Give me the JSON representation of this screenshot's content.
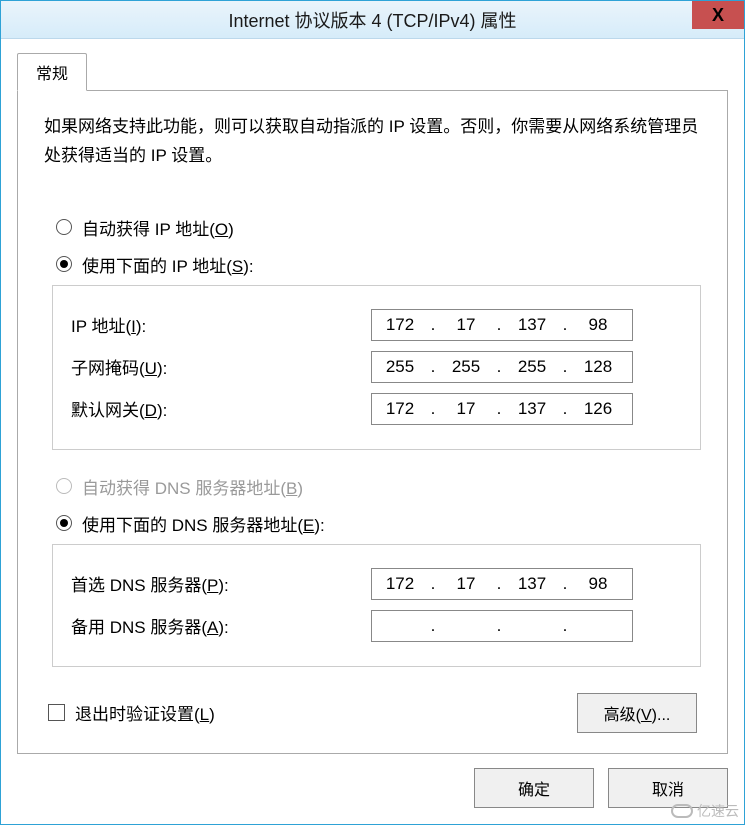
{
  "window": {
    "title": "Internet 协议版本 4 (TCP/IPv4) 属性",
    "close": "X"
  },
  "tab": {
    "general": "常规"
  },
  "description": "如果网络支持此功能，则可以获取自动指派的 IP 设置。否则，你需要从网络系统管理员处获得适当的 IP 设置。",
  "radios": {
    "auto_ip_prefix": "自动获得 IP 地址(",
    "auto_ip_key": "O",
    "auto_ip_suffix": ")",
    "manual_ip_prefix": "使用下面的 IP 地址(",
    "manual_ip_key": "S",
    "manual_ip_suffix": "):",
    "auto_dns_prefix": "自动获得 DNS 服务器地址(",
    "auto_dns_key": "B",
    "auto_dns_suffix": ")",
    "manual_dns_prefix": "使用下面的 DNS 服务器地址(",
    "manual_dns_key": "E",
    "manual_dns_suffix": "):"
  },
  "fields": {
    "ip": {
      "label_prefix": "IP 地址(",
      "key": "I",
      "label_suffix": "):",
      "o1": "172",
      "o2": "17",
      "o3": "137",
      "o4": "98"
    },
    "mask": {
      "label_prefix": "子网掩码(",
      "key": "U",
      "label_suffix": "):",
      "o1": "255",
      "o2": "255",
      "o3": "255",
      "o4": "128"
    },
    "gateway": {
      "label_prefix": "默认网关(",
      "key": "D",
      "label_suffix": "):",
      "o1": "172",
      "o2": "17",
      "o3": "137",
      "o4": "126"
    },
    "dns1": {
      "label_prefix": "首选 DNS 服务器(",
      "key": "P",
      "label_suffix": "):",
      "o1": "172",
      "o2": "17",
      "o3": "137",
      "o4": "98"
    },
    "dns2": {
      "label_prefix": "备用 DNS 服务器(",
      "key": "A",
      "label_suffix": "):",
      "o1": "",
      "o2": "",
      "o3": "",
      "o4": ""
    }
  },
  "validate": {
    "prefix": "退出时验证设置(",
    "key": "L",
    "suffix": ")"
  },
  "buttons": {
    "advanced_prefix": "高级(",
    "advanced_key": "V",
    "advanced_suffix": ")...",
    "ok": "确定",
    "cancel": "取消"
  },
  "watermark": "亿速云"
}
